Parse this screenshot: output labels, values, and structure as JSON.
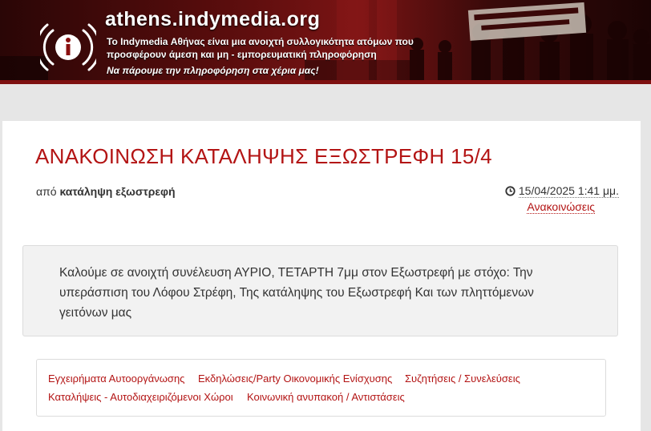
{
  "header": {
    "site_title": "athens.indymedia.org",
    "tagline": "Το Indymedia Αθήνας είναι μια ανοιχτή συλλογικότητα ατόμων που προσφέρουν άμεση και μη - εμπορευματική πληροφόρηση",
    "slogan": "Να πάρουμε την πληροφόρηση στα χέρια μας!",
    "logo_icon": "indymedia-i-broadcast-icon",
    "banner_text": "ΕΙΜΑΣΤΕ Ο ΔΗΜΟΣ ... ΕΛΛΗΝΙΚΗΣ ΝΕΟΛΑΙΑΣ",
    "colors": {
      "banner_dark": "#2a0606",
      "banner_red": "#7a1414"
    }
  },
  "article": {
    "title": "ΑΝΑΚΟΙΝΩΣΗ ΚΑΤΑΛΗΨΗΣ ΕΞΩΣΤΡΕΦΗ 15/4",
    "by_prefix": "από",
    "author": "κατάληψη εξωστρεφή",
    "date_icon": "clock-icon",
    "date": "15/04/2025 1:41 μμ.",
    "category": "Ανακοινώσεις",
    "summary": "Καλούμε σε ανοιχτή συνέλευση ΑΥΡΙΟ, ΤΕΤΑΡΤΗ 7μμ στον Εξωστρεφή με στόχο: Την υπεράσπιση του Λόφου Στρέφη, Της κατάληψης του Εξωστρεφή Και των πληττόμενων γειτόνων μας",
    "accent_color": "#b31414"
  },
  "tags": [
    "Εγχειρήματα Αυτοοργάνωσης",
    "Εκδηλώσεις/Party Οικονομικής Ενίσχυσης",
    "Συζητήσεις / Συνελεύσεις",
    "Καταλήψεις - Αυτοδιαχειριζόμενοι Χώροι",
    "Κοινωνική ανυπακοή / Αντιστάσεις"
  ]
}
